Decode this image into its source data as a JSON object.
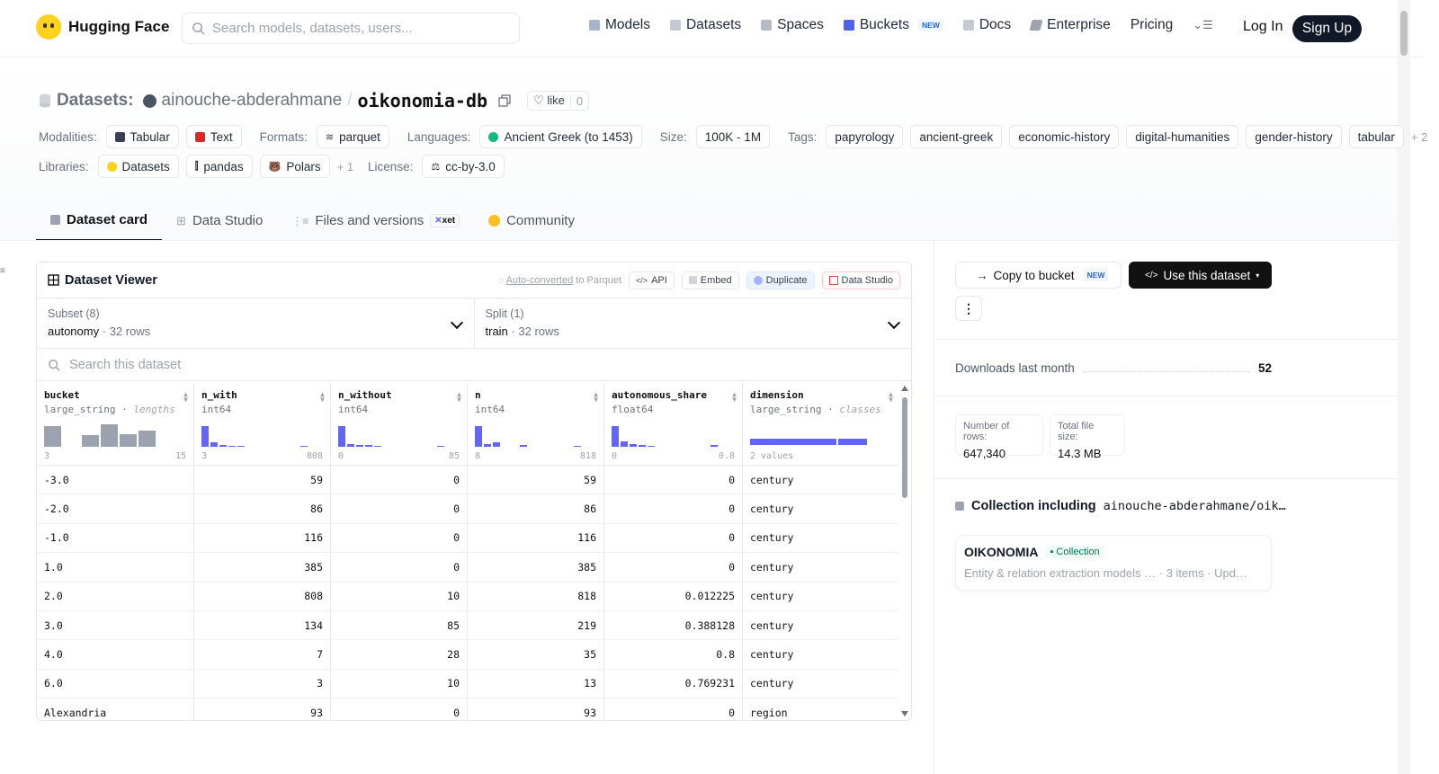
{
  "header": {
    "brand": "Hugging Face",
    "search_placeholder": "Search models, datasets, users...",
    "nav": [
      {
        "label": "Models",
        "icon": "cube-icon"
      },
      {
        "label": "Datasets",
        "icon": "database-icon"
      },
      {
        "label": "Spaces",
        "icon": "grid-icon"
      },
      {
        "label": "Buckets",
        "icon": "bucket-icon",
        "badge": "NEW"
      },
      {
        "label": "Docs",
        "icon": "book-icon"
      },
      {
        "label": "Enterprise",
        "icon": "building-icon"
      },
      {
        "label": "Pricing"
      }
    ],
    "login": "Log In",
    "signup": "Sign Up"
  },
  "dataset": {
    "label": "Datasets:",
    "owner": "ainouche-abderahmane",
    "sep": "/",
    "name": "oikonomia-db",
    "like_label": "like",
    "like_count": "0"
  },
  "meta": {
    "modalities_label": "Modalities:",
    "modalities": [
      "Tabular",
      "Text"
    ],
    "formats_label": "Formats:",
    "formats": [
      "parquet"
    ],
    "languages_label": "Languages:",
    "languages": [
      "Ancient Greek (to 1453)"
    ],
    "size_label": "Size:",
    "size": "100K - 1M",
    "tags_label": "Tags:",
    "tags": [
      "papyrology",
      "ancient-greek",
      "economic-history",
      "digital-humanities",
      "gender-history",
      "tabular"
    ],
    "tags_more": "+ 2",
    "libraries_label": "Libraries:",
    "libraries": [
      "Datasets",
      "pandas",
      "Polars"
    ],
    "libraries_more": "+ 1",
    "license_label": "License:",
    "license": "cc-by-3.0"
  },
  "tabs": [
    {
      "label": "Dataset card",
      "active": true
    },
    {
      "label": "Data Studio"
    },
    {
      "label": "Files and versions",
      "badge": "xet"
    },
    {
      "label": "Community"
    }
  ],
  "viewer": {
    "title": "Dataset Viewer",
    "auto_converted_prefix": "Auto-converted",
    "auto_converted_suffix": " to Parquet",
    "tools": [
      "API",
      "Embed",
      "Duplicate",
      "Data Studio"
    ],
    "subset_label": "Subset (8)",
    "subset_value": "autonomy",
    "subset_rows": "32 rows",
    "split_label": "Split (1)",
    "split_value": "train",
    "split_rows": "32 rows",
    "search_placeholder": "Search this dataset",
    "columns": [
      {
        "name": "bucket",
        "type": "large_string",
        "note": "lengths",
        "min": "3",
        "max": "15",
        "hist": [
          0.9,
          0,
          0.5,
          0.95,
          0.55,
          0.7
        ],
        "gray": true
      },
      {
        "name": "n_with",
        "type": "int64",
        "min": "3",
        "max": "808",
        "hist": [
          0.9,
          0.2,
          0.08,
          0.05,
          0.05,
          0,
          0,
          0,
          0,
          0,
          0,
          0.04
        ]
      },
      {
        "name": "n_without",
        "type": "int64",
        "min": "0",
        "max": "85",
        "hist": [
          0.9,
          0.12,
          0.06,
          0.08,
          0.04,
          0,
          0,
          0,
          0,
          0,
          0,
          0.04
        ]
      },
      {
        "name": "n",
        "type": "int64",
        "min": "8",
        "max": "818",
        "hist": [
          0.9,
          0.1,
          0.18,
          0,
          0,
          0.06,
          0,
          0,
          0,
          0,
          0,
          0.04
        ]
      },
      {
        "name": "autonomous_share",
        "type": "float64",
        "min": "0",
        "max": "0.8",
        "hist": [
          0.9,
          0.22,
          0.12,
          0.08,
          0.05,
          0,
          0,
          0,
          0,
          0,
          0,
          0.08
        ]
      },
      {
        "name": "dimension",
        "type": "large_string",
        "note": "classes",
        "classes_label": "2 values",
        "class_split": [
          0.75,
          0.25
        ]
      }
    ],
    "rows": [
      [
        "-3.0",
        "59",
        "0",
        "59",
        "0",
        "century"
      ],
      [
        "-2.0",
        "86",
        "0",
        "86",
        "0",
        "century"
      ],
      [
        "-1.0",
        "116",
        "0",
        "116",
        "0",
        "century"
      ],
      [
        "1.0",
        "385",
        "0",
        "385",
        "0",
        "century"
      ],
      [
        "2.0",
        "808",
        "10",
        "818",
        "0.012225",
        "century"
      ],
      [
        "3.0",
        "134",
        "85",
        "219",
        "0.388128",
        "century"
      ],
      [
        "4.0",
        "7",
        "28",
        "35",
        "0.8",
        "century"
      ],
      [
        "6.0",
        "3",
        "10",
        "13",
        "0.769231",
        "century"
      ],
      [
        "Alexandria",
        "93",
        "0",
        "93",
        "0",
        "region"
      ]
    ]
  },
  "sidebar": {
    "copy_label": "Copy to bucket",
    "copy_badge": "NEW",
    "use_label": "Use this dataset",
    "downloads_label": "Downloads last month",
    "downloads_value": "52",
    "rows_label": "Number of rows:",
    "rows_value": "647,340",
    "size_label": "Total file size:",
    "size_value": "14.3 MB",
    "collection_prefix": "Collection including",
    "collection_repo": "ainouche-abderahmane/oik…",
    "collection_name": "OIKONOMIA",
    "collection_tag": "Collection",
    "collection_desc": "Entity & relation extraction models …  ·  3 items  ·  Upd…"
  },
  "colors": {
    "accent": "#6366f1",
    "dark": "#111827",
    "logo": "#ffd21e"
  }
}
